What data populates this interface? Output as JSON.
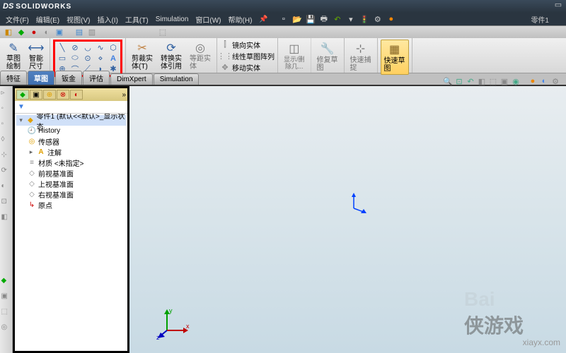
{
  "app": {
    "vendor": "DS",
    "name": "SOLIDWORKS",
    "doc_title": "零件1"
  },
  "menus": [
    "文件(F)",
    "编辑(E)",
    "视图(V)",
    "插入(I)",
    "工具(T)",
    "Simulation",
    "窗口(W)",
    "帮助(H)"
  ],
  "ribbon": {
    "sketch_label": "草图\n绘制",
    "dim_label": "智能\n尺寸",
    "trim": {
      "label": "剪裁实\n体(T)",
      "convert": "转换实\n体引用"
    },
    "offset_label": "等距实\n体",
    "mirror": {
      "row1": "镜向实体",
      "row2": "线性草图阵列",
      "row3": "移动实体"
    },
    "display": {
      "row1": "显示/删",
      "row2": "除几..."
    },
    "repair_label": "修复草\n图",
    "quick_snap": "快速捕\n捉",
    "quick_sketch": "快速草\n图"
  },
  "tabs": [
    "特征",
    "草图",
    "钣金",
    "评估",
    "DimXpert",
    "Simulation"
  ],
  "active_tab": 1,
  "tree": {
    "root": "零件1  (默认<<默认>_显示状态",
    "history": "History",
    "sensors": "传感器",
    "annotations": "注解",
    "material": "材质 <未指定>",
    "front": "前视基准面",
    "top": "上视基准面",
    "right": "右视基准面",
    "origin": "原点"
  },
  "watermark": {
    "text": "xiayx.com",
    "logo": "侠游戏",
    "bai": "Bai"
  }
}
